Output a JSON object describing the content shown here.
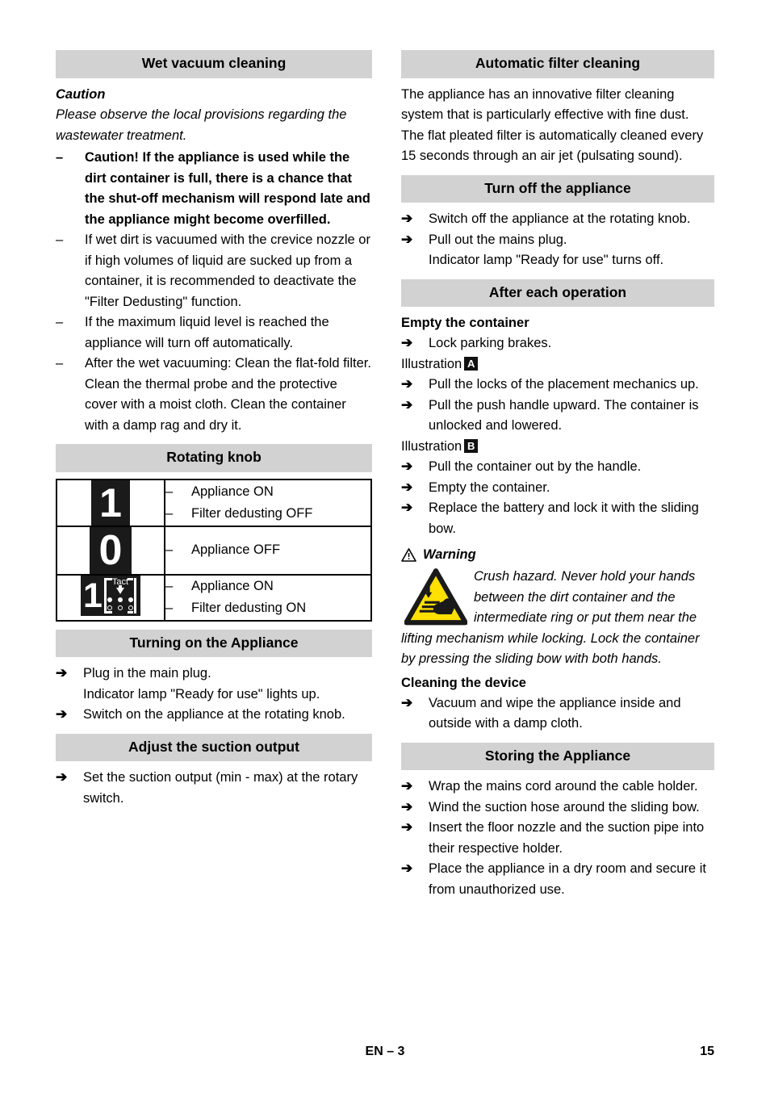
{
  "page": {
    "footer_center": "EN – 3",
    "footer_page_number": "15",
    "header_bg": "#d2d2d2"
  },
  "left_column": {
    "wet_vacuum": {
      "heading": "Wet vacuum cleaning",
      "caution_label": "Caution",
      "caution_text": "Please observe the local provisions regarding the wastewater treatment.",
      "items": [
        {
          "marker": "–",
          "bold": true,
          "text": "Caution! If the appliance is used while the dirt container is full, there is a chance that the shut-off mechanism will respond late and the appliance might become overfilled."
        },
        {
          "marker": "–",
          "bold": false,
          "text": "If wet dirt is vacuumed with the crevice nozzle or if high volumes of liquid are sucked up from a container, it is recommended to deactivate the \"Filter Dedusting\" function."
        },
        {
          "marker": "–",
          "bold": false,
          "text": "If the maximum liquid level is reached the appliance will turn off automatically."
        },
        {
          "marker": "–",
          "bold": false,
          "text": "After the wet vacuuming: Clean the flat-fold filter. Clean the thermal probe and the protective cover with a moist cloth. Clean the container with a damp rag and dry it."
        }
      ]
    },
    "rotating_knob": {
      "heading": "Rotating knob",
      "rows": [
        {
          "icon": "knob-position-1-icon",
          "icon_text": "1",
          "items": [
            "Appliance ON",
            "Filter dedusting OFF"
          ]
        },
        {
          "icon": "knob-position-0-icon",
          "icon_text": "0",
          "items": [
            "Appliance OFF"
          ]
        },
        {
          "icon": "knob-position-1-tact-icon",
          "icon_text": "1",
          "icon_label": "Tact",
          "items": [
            "Appliance ON",
            "Filter dedusting ON"
          ]
        }
      ],
      "dash": "–"
    },
    "turning_on": {
      "heading": "Turning on the Appliance",
      "steps": [
        {
          "text": "Plug in the main plug.",
          "subline": "Indicator lamp \"Ready for use\" lights up."
        },
        {
          "text": "Switch on the appliance at the rotating knob.",
          "subline": ""
        }
      ]
    },
    "suction_output": {
      "heading": "Adjust the suction output",
      "steps": [
        {
          "text": "Set the suction output (min - max) at the rotary switch.",
          "subline": ""
        }
      ]
    }
  },
  "right_column": {
    "auto_filter": {
      "heading": "Automatic filter cleaning",
      "text": "The appliance has an innovative filter cleaning system that is particularly effective with fine dust. The flat pleated filter is automatically cleaned every 15 seconds through an air jet (pulsating sound)."
    },
    "turn_off": {
      "heading": "Turn off the appliance",
      "steps": [
        {
          "text": "Switch off the appliance at the rotating knob.",
          "subline": ""
        },
        {
          "text": "Pull out the mains plug.",
          "subline": "Indicator lamp \"Ready for use\" turns off."
        }
      ]
    },
    "after_each_operation": {
      "heading": "After each operation",
      "empty_container": {
        "sub_heading": "Empty the container",
        "step_0": "Lock parking brakes.",
        "illustration_a_label": "Illustration",
        "illustration_a_badge": "A",
        "steps_a": [
          "Pull the locks of the placement mechanics up.",
          "Pull the push handle upward. The container is unlocked and lowered."
        ],
        "illustration_b_label": "Illustration",
        "illustration_b_badge": "B",
        "steps_b": [
          "Pull the container out by the handle.",
          "Empty the container.",
          "Replace the battery and lock it with the sliding bow."
        ]
      },
      "warning": {
        "label": "Warning",
        "text": "Crush hazard. Never hold your hands between the dirt container and the intermediate ring or put them near the lifting mechanism while locking. Lock the container by pressing the sliding bow with both hands.",
        "icon_colors": {
          "fill": "#ffe000",
          "stroke": "#1a1a1a"
        }
      },
      "cleaning_device": {
        "sub_heading": "Cleaning the device",
        "steps": [
          "Vacuum and wipe the appliance inside and outside with a damp cloth."
        ]
      }
    },
    "storing": {
      "heading": "Storing the Appliance",
      "steps": [
        "Wrap the mains cord around the cable holder.",
        "Wind the suction hose around the sliding bow.",
        "Insert the floor nozzle and the suction pipe into their respective holder.",
        "Place the appliance in a dry room and secure it from unauthorized use."
      ]
    }
  },
  "glyphs": {
    "arrow_bullet": "➔",
    "dash_bullet": "–"
  }
}
